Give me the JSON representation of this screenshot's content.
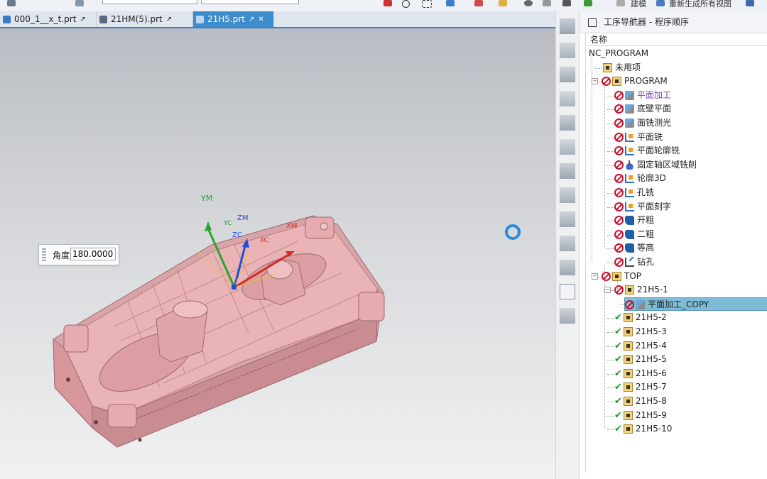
{
  "toolbar": {
    "items": [
      "建模",
      "重新生成所有视图"
    ]
  },
  "tabs": [
    {
      "label": "000_1__x_t.prt",
      "active": false
    },
    {
      "label": "21HM(5).prt",
      "active": false
    },
    {
      "label": "21H5.prt",
      "active": true
    }
  ],
  "viewport": {
    "triad": {
      "ym": "YM",
      "zm": "ZM",
      "xm": "XM",
      "zc": "ZC",
      "yc": "YC",
      "xc": "XC"
    },
    "angle_dialog": {
      "label": "角度",
      "value": "180.00000"
    }
  },
  "navigator": {
    "title": "工序导航器 - 程序顺序",
    "column_header": "名称",
    "colors": {
      "selected_row": "#7fbcd6",
      "status_red": "#c8102e",
      "status_ok": "#1a9d1a",
      "highlight_text": "#7a3fb0"
    },
    "tree": [
      {
        "label": "NC_PROGRAM",
        "level": 0,
        "status": "none",
        "icon": "none"
      },
      {
        "label": "未用项",
        "level": 1,
        "status": "none",
        "icon": "folder-icon"
      },
      {
        "label": "PROGRAM",
        "level": 1,
        "status": "red",
        "icon": "folder-icon",
        "expander": "minus"
      },
      {
        "label": "平面加工",
        "level": 2,
        "status": "red",
        "icon": "face-mill-icon",
        "highlight": true
      },
      {
        "label": "底壁平面",
        "level": 2,
        "status": "red",
        "icon": "face-mill-icon"
      },
      {
        "label": "面铣测光",
        "level": 2,
        "status": "red",
        "icon": "face-mill-icon"
      },
      {
        "label": "平面铣",
        "level": 2,
        "status": "red",
        "icon": "planar-mill-icon"
      },
      {
        "label": "平面轮廓铣",
        "level": 2,
        "status": "red",
        "icon": "planar-mill-icon"
      },
      {
        "label": "固定轴区域铣削",
        "level": 2,
        "status": "red",
        "icon": "fixed-axis-icon"
      },
      {
        "label": "轮廓3D",
        "level": 2,
        "status": "red",
        "icon": "planar-mill-icon"
      },
      {
        "label": "孔铣",
        "level": 2,
        "status": "red",
        "icon": "planar-mill-icon"
      },
      {
        "label": "平面刻字",
        "level": 2,
        "status": "red",
        "icon": "planar-mill-icon"
      },
      {
        "label": "开粗",
        "level": 2,
        "status": "red",
        "icon": "cavity-mill-icon"
      },
      {
        "label": "二粗",
        "level": 2,
        "status": "red",
        "icon": "cavity-mill-icon"
      },
      {
        "label": "等高",
        "level": 2,
        "status": "red",
        "icon": "cavity-mill-icon"
      },
      {
        "label": "钻孔",
        "level": 2,
        "status": "red",
        "icon": "drill-icon"
      },
      {
        "label": "TOP",
        "level": 1,
        "status": "red",
        "icon": "folder-icon",
        "expander": "minus"
      },
      {
        "label": "21H5-1",
        "level": 2,
        "status": "red",
        "icon": "folder-icon",
        "expander": "minus"
      },
      {
        "label": "平面加工_COPY",
        "level": 3,
        "status": "red",
        "icon": "face-mill-icon",
        "selected": true
      },
      {
        "label": "21H5-2",
        "level": 2,
        "status": "ok",
        "icon": "folder-icon"
      },
      {
        "label": "21H5-3",
        "level": 2,
        "status": "ok",
        "icon": "folder-icon"
      },
      {
        "label": "21H5-4",
        "level": 2,
        "status": "ok",
        "icon": "folder-icon"
      },
      {
        "label": "21H5-5",
        "level": 2,
        "status": "ok",
        "icon": "folder-icon"
      },
      {
        "label": "21H5-6",
        "level": 2,
        "status": "ok",
        "icon": "folder-icon"
      },
      {
        "label": "21H5-7",
        "level": 2,
        "status": "ok",
        "icon": "folder-icon"
      },
      {
        "label": "21H5-8",
        "level": 2,
        "status": "ok",
        "icon": "folder-icon"
      },
      {
        "label": "21H5-9",
        "level": 2,
        "status": "ok",
        "icon": "folder-icon"
      },
      {
        "label": "21H5-10",
        "level": 2,
        "status": "ok",
        "icon": "folder-icon"
      }
    ]
  }
}
